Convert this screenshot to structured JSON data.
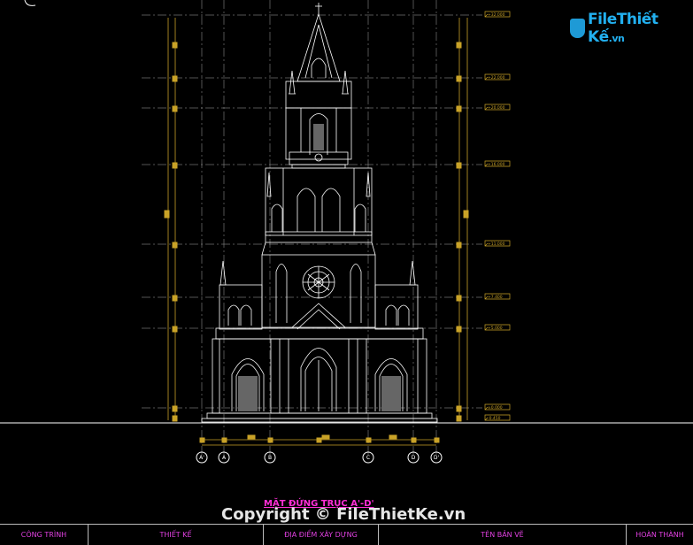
{
  "logo": {
    "text_main": "FileThiết Kế",
    "text_suffix": ".vn"
  },
  "drawing": {
    "sheet_title": "MẶT ĐỨNG TRỤC A'-D'",
    "axis_labels": [
      "A'",
      "A",
      "B",
      "C",
      "D",
      "D'"
    ],
    "level_marks": [
      "+32.000",
      "+22.000",
      "+20.000",
      "+16.000",
      "+11.000",
      "+7.400",
      "+5.000",
      "±0.000",
      "-0.450"
    ]
  },
  "watermark": {
    "text": "Copyright © FileThietKe.vn"
  },
  "title_bar": {
    "cells": [
      {
        "label": "CÔNG TRÌNH"
      },
      {
        "label": "THIẾT KẾ"
      },
      {
        "label": "ĐỊA ĐIỂM XÂY DỰNG"
      },
      {
        "label": "TÊN BẢN VẼ"
      },
      {
        "label": "HOÀN THÀNH"
      }
    ]
  },
  "colors": {
    "background": "#000000",
    "lines": "#ffffff",
    "dimension": "#c9a227",
    "accent": "#ff2fd6",
    "logo": "#22b0f0"
  }
}
